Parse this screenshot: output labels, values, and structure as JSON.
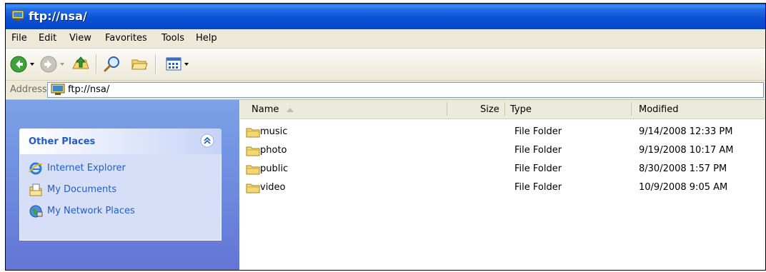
{
  "window": {
    "title": "ftp://nsa/"
  },
  "menu": [
    "File",
    "Edit",
    "View",
    "Favorites",
    "Tools",
    "Help"
  ],
  "address": {
    "label": "Address",
    "value": "ftp://nsa/"
  },
  "task_pane": {
    "section_title": "Other Places",
    "items": [
      {
        "label": "Internet Explorer",
        "icon": "internet-explorer-icon"
      },
      {
        "label": "My Documents",
        "icon": "my-documents-icon"
      },
      {
        "label": "My Network Places",
        "icon": "network-places-icon"
      }
    ]
  },
  "columns": {
    "name": "Name",
    "size": "Size",
    "type": "Type",
    "modified": "Modified"
  },
  "files": [
    {
      "name": "music",
      "type": "File Folder",
      "modified": "9/14/2008 12:33 PM"
    },
    {
      "name": "photo",
      "type": "File Folder",
      "modified": "9/19/2008 10:17 AM"
    },
    {
      "name": "public",
      "type": "File Folder",
      "modified": "8/30/2008 1:57 PM"
    },
    {
      "name": "video",
      "type": "File Folder",
      "modified": "10/9/2008 9:05 AM"
    }
  ],
  "colors": {
    "title_blue": "#0b53d6",
    "task_pane_blue": "#6f8ee0",
    "link_blue": "#215dc6"
  }
}
